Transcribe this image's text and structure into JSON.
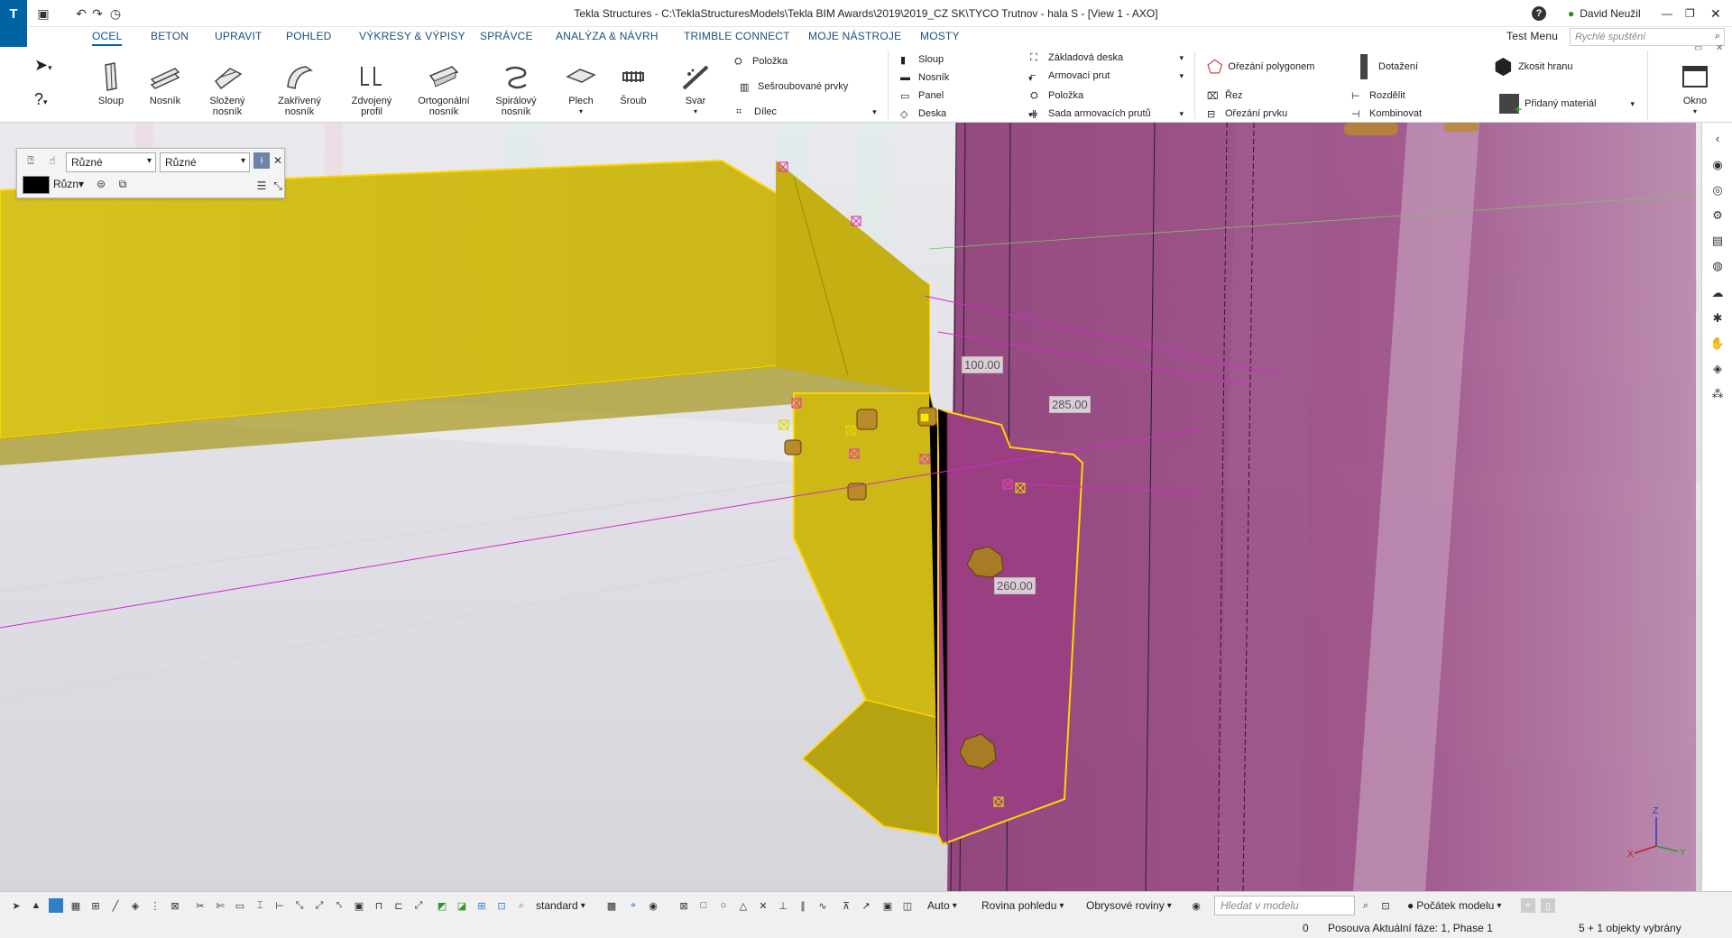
{
  "window": {
    "title": "Tekla Structures - C:\\TeklaStructuresModels\\Tekla BIM Awards\\2019\\2019_CZ SK\\TYCO Trutnov - hala S  - [View 1 - AXO]",
    "user": "David Neužil",
    "help_icon": "?"
  },
  "menu": {
    "tabs": [
      "OCEL",
      "BETON",
      "UPRAVIT",
      "POHLED",
      "VÝKRESY & VÝPISY",
      "SPRÁVCE",
      "ANALÝZA & NÁVRH",
      "TRIMBLE CONNECT",
      "MOJE NÁSTROJE",
      "MOSTY"
    ],
    "active_tab": "OCEL",
    "test_menu": "Test Menu",
    "search_placeholder": "Rychlé spuštění"
  },
  "ribbon": {
    "large_buttons": [
      {
        "label": "Sloup",
        "icon": "column-icon"
      },
      {
        "label": "Nosník",
        "icon": "beam-icon"
      },
      {
        "label": "Složený nosník",
        "icon": "polybeam-icon"
      },
      {
        "label": "Zakřivený nosník",
        "icon": "curved-beam-icon"
      },
      {
        "label": "Zdvojený profil",
        "icon": "twin-profile-icon"
      },
      {
        "label": "Ortogonální nosník",
        "icon": "orthogonal-beam-icon"
      },
      {
        "label": "Spirálový nosník",
        "icon": "spiral-beam-icon"
      },
      {
        "label": "Plech",
        "icon": "plate-icon"
      },
      {
        "label": "Šroub",
        "icon": "bolt-icon"
      },
      {
        "label": "Svar",
        "icon": "weld-icon"
      }
    ],
    "steel_small": [
      {
        "label": "Položka"
      },
      {
        "label": "Sešroubované prvky"
      },
      {
        "label": "Dílec"
      }
    ],
    "concrete_small": [
      {
        "label": "Sloup"
      },
      {
        "label": "Nosník"
      },
      {
        "label": "Panel"
      },
      {
        "label": "Deska"
      }
    ],
    "concrete_small2": [
      {
        "label": "Základová deska"
      },
      {
        "label": "Armovací prut"
      },
      {
        "label": "Položka"
      },
      {
        "label": "Sada armovacích prutů"
      }
    ],
    "edit_tools": [
      {
        "label": "Ořezání polygonem"
      },
      {
        "label": "Řez"
      },
      {
        "label": "Ořezání prvku"
      }
    ],
    "edit_tools2": [
      {
        "label": "Dotažení"
      },
      {
        "label": "Rozdělit"
      },
      {
        "label": "Kombinovat"
      }
    ],
    "edit_tools3": [
      {
        "label": "Zkosit hranu"
      },
      {
        "label": "Přidaný materiál"
      }
    ],
    "window_button": "Okno"
  },
  "select_panel": {
    "filter1": "Různé",
    "filter2": "Různé",
    "color_label": "Různ"
  },
  "dimensions": [
    "100.00",
    "285.00",
    "260.00"
  ],
  "axes": {
    "x": "X",
    "y": "Y",
    "z": "Z"
  },
  "bottom_toolbar": {
    "view_filter": "standard",
    "snap_mode": "Auto",
    "plane": "Rovina pohledu",
    "outline_planes": "Obrysové roviny",
    "search_placeholder": "Hledat v modelu",
    "origin": "Počátek modelu"
  },
  "status": {
    "count": "0",
    "phase": "Posouva  Aktuální fáze: 1, Phase 1",
    "selected": "5 + 1 objekty vybrány"
  },
  "colors": {
    "accent": "#0063a3",
    "beam_yellow": "#d8c21c",
    "column_magenta": "#8a3573",
    "highlight_outline": "#ffd400"
  }
}
